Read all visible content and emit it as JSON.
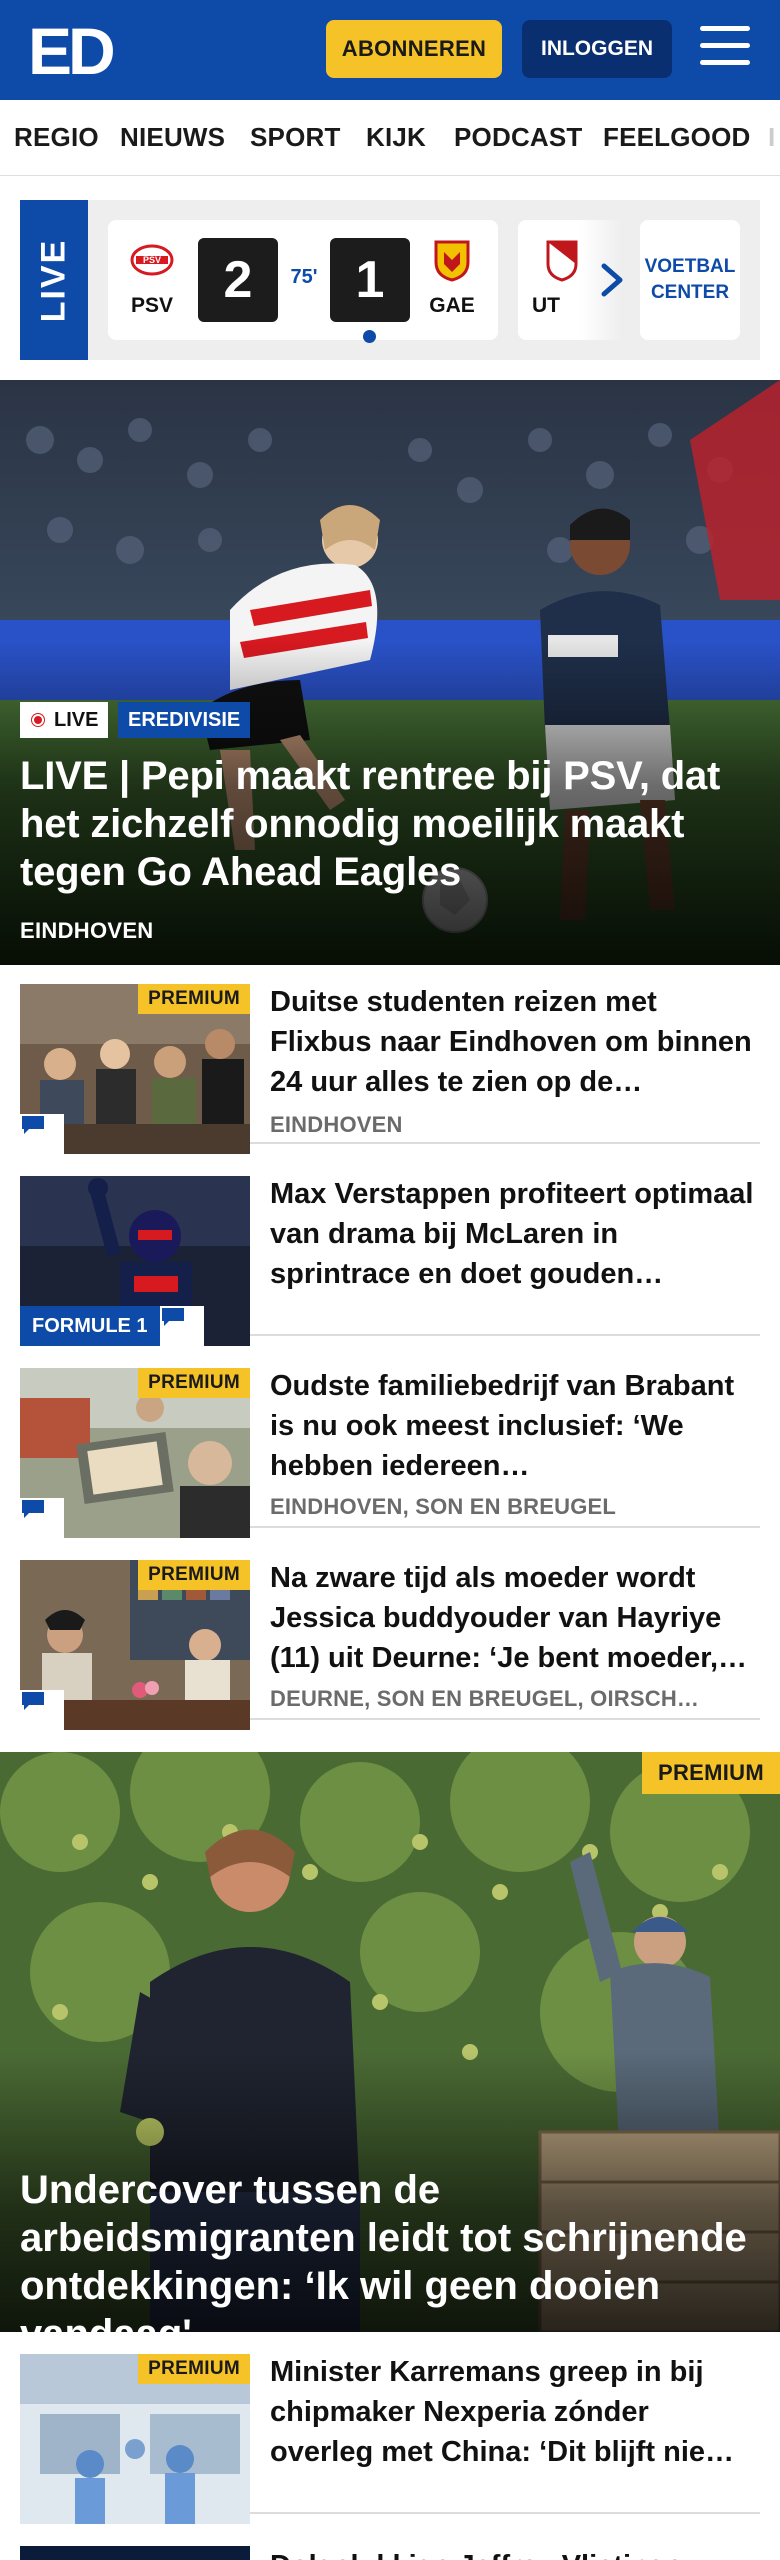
{
  "header": {
    "logo_text": "ED",
    "subscribe_label": "ABONNEREN",
    "login_label": "INLOGGEN",
    "brand_color": "#0e4aa8",
    "accent_color": "#f5c227"
  },
  "nav": {
    "items": [
      "REGIO",
      "NIEUWS",
      "SPORT",
      "KIJK",
      "PODCAST",
      "FEELGOOD"
    ]
  },
  "scores": {
    "live_label": "LIVE",
    "match": {
      "home_team": "PSV",
      "home_score": "2",
      "minute": "75'",
      "away_score": "1",
      "away_team": "GAE"
    },
    "next_match_team": "UT",
    "voetbal_center_label": "VOETBAL CENTER"
  },
  "hero": {
    "live_badge": "LIVE",
    "category": "EREDIVISIE",
    "title": "LIVE | Pepi maakt rentree bij PSV, dat het zichzelf onnodig moeilijk maakt tegen Go Ahead Eagles",
    "location": "EINDHOVEN"
  },
  "articles": [
    {
      "badge": "PREMIUM",
      "title": "Duitse studenten reizen met Flixbus naar Eindhoven om binnen 24 uur alles te zien op de…",
      "location": "EINDHOVEN"
    },
    {
      "tag": "FORMULE 1",
      "title": "Max Verstappen profiteert optimaal van drama bij McLaren in sprintrace en doet gouden…"
    },
    {
      "badge": "PREMIUM",
      "title": "Oudste familiebedrijf van Brabant is nu ook meest inclusief: ‘We hebben iedereen…",
      "location": "EINDHOVEN, SON EN BREUGEL"
    },
    {
      "badge": "PREMIUM",
      "title": "Na zware tijd als moeder wordt Jessica buddyouder van Hayriye (11) uit Deurne: ‘Je bent moeder,…",
      "location": "DEURNE, SON EN BREUGEL, OIRSCH…"
    }
  ],
  "feature": {
    "badge": "PREMIUM",
    "title": "Undercover tussen de arbeidsmigranten leidt tot schrijnende ontdekkingen: ‘Ik wil geen dooien vandaag'"
  },
  "article_after": {
    "badge": "PREMIUM",
    "title": "Minister Karremans greep in bij chipmaker Nexperia zónder overleg met China: ‘Dit blijft nie…"
  },
  "article_cut": {
    "title": "Dolgelukkige Jeffrey Vlietinge"
  }
}
